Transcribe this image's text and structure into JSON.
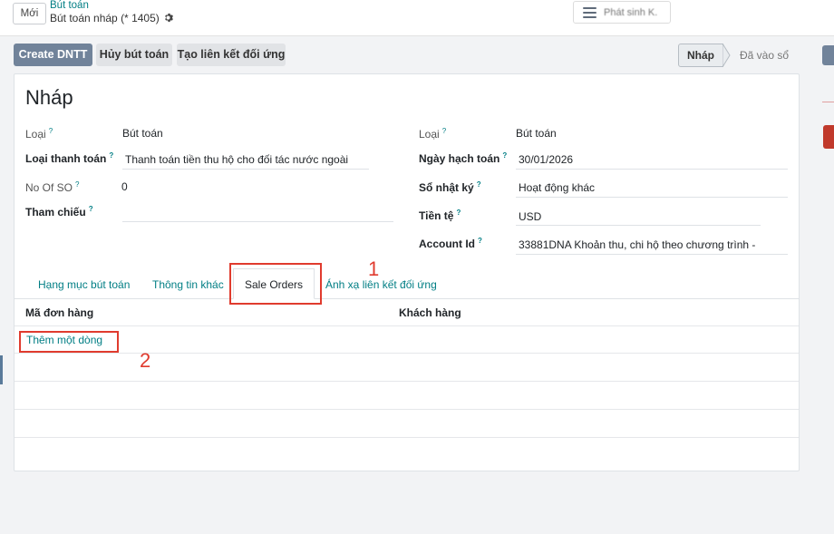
{
  "topbar": {
    "new_label": "Mới",
    "breadcrumb_parent": "Bút toán",
    "breadcrumb_current": "Bút toán nháp (* 1405)",
    "center_button_label": "Phát sinh K."
  },
  "actions": {
    "create": "Create DNTT",
    "cancel": "Hủy bút toán",
    "link": "Tạo liên kết đối ứng"
  },
  "statusbar": {
    "active": "Nháp",
    "next": "Đã vào sổ"
  },
  "form": {
    "title": "Nháp",
    "left": {
      "loai_label": "Loại",
      "loai_value": "Bút toán",
      "payment_type_label": "Loại thanh toán",
      "payment_type_value": "Thanh toán tiền thu hộ cho đối tác nước ngoài",
      "no_of_so_label": "No Of SO",
      "no_of_so_value": "0",
      "ref_label": "Tham chiếu",
      "ref_value": ""
    },
    "right": {
      "loai_label": "Loại",
      "loai_value": "Bút toán",
      "date_label": "Ngày hạch toán",
      "date_value": "30/01/2026",
      "journal_label": "Sổ nhật ký",
      "journal_value": "Hoạt động khác",
      "currency_label": "Tiền tệ",
      "currency_value": "USD",
      "account_label": "Account Id",
      "account_value": "33881DNA Khoản thu, chi hộ theo chương trình -"
    },
    "help_mark": "?"
  },
  "tabs": [
    "Hạng mục bút toán",
    "Thông tin khác",
    "Sale Orders",
    "Ánh xạ liên kết đối ứng"
  ],
  "table": {
    "columns": [
      "Mã đơn hàng",
      "Khách hàng"
    ],
    "add_line": "Thêm một dòng"
  },
  "annotations": [
    "1",
    "2"
  ],
  "colors": {
    "primary": "#71839a",
    "link": "#017e84",
    "annotation": "#e03b2e"
  }
}
